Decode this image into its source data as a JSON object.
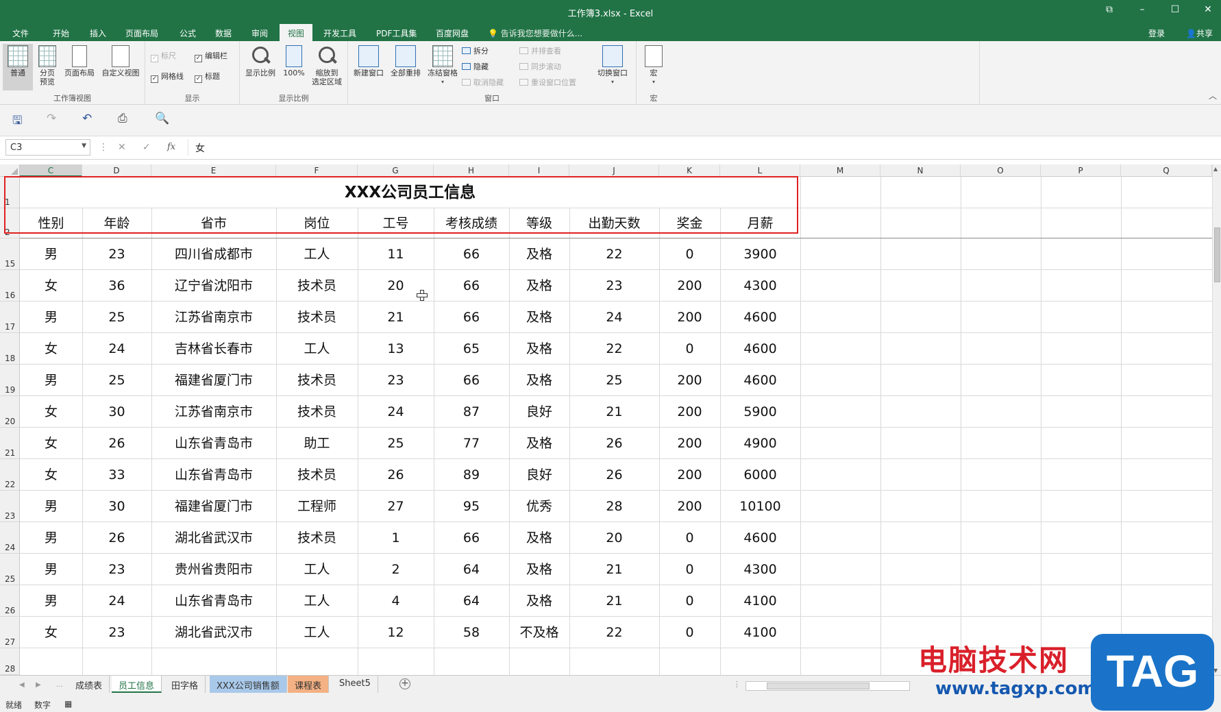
{
  "window": {
    "title": "工作簿3.xlsx - Excel",
    "buttons": [
      "⧉",
      "–",
      "☐",
      "✕"
    ]
  },
  "menu": {
    "tabs": [
      "文件",
      "开始",
      "插入",
      "页面布局",
      "公式",
      "数据",
      "审阅",
      "视图",
      "开发工具",
      "PDF工具集",
      "百度网盘"
    ],
    "active_tab": "视图",
    "tell_me": "告诉我您想要做什么...",
    "login": "登录",
    "share": "共享"
  },
  "ribbon": {
    "workbook_views": {
      "label": "工作簿视图",
      "normal": "普通",
      "page_break": "分页\n预览",
      "page_layout": "页面布局",
      "custom": "自定义视图"
    },
    "show": {
      "label": "显示",
      "ruler": "标尺",
      "formula_bar": "编辑栏",
      "gridlines": "网格线",
      "headings": "标题"
    },
    "zoom": {
      "label": "显示比例",
      "zoom": "显示比例",
      "hundred": "100%",
      "to_selection": "缩放到\n选定区域"
    },
    "window": {
      "label": "窗口",
      "new_window": "新建窗口",
      "arrange_all": "全部重排",
      "freeze_panes": "冻结窗格",
      "split": "拆分",
      "hide": "隐藏",
      "unhide": "取消隐藏",
      "side_by_side": "并排查看",
      "sync_scroll": "同步滚动",
      "reset_position": "重设窗口位置",
      "switch_windows": "切换窗口"
    },
    "macros": {
      "label": "宏",
      "macros": "宏"
    }
  },
  "formula_bar": {
    "name_box": "C3",
    "value": "女"
  },
  "sheet": {
    "columns": [
      "C",
      "D",
      "E",
      "F",
      "G",
      "H",
      "I",
      "J",
      "K",
      "L",
      "M",
      "N",
      "O",
      "P",
      "Q"
    ],
    "selected_column": "C",
    "title": "XXX公司员工信息",
    "headers": [
      "性别",
      "年龄",
      "省市",
      "岗位",
      "工号",
      "考核成绩",
      "等级",
      "出勤天数",
      "奖金",
      "月薪"
    ],
    "row_numbers": [
      "1",
      "2",
      "15",
      "16",
      "17",
      "18",
      "19",
      "20",
      "21",
      "22",
      "23",
      "24",
      "25",
      "26",
      "27",
      "28"
    ],
    "rows": [
      [
        "男",
        "23",
        "四川省成都市",
        "工人",
        "11",
        "66",
        "及格",
        "22",
        "0",
        "3900"
      ],
      [
        "女",
        "36",
        "辽宁省沈阳市",
        "技术员",
        "20",
        "66",
        "及格",
        "23",
        "200",
        "4300"
      ],
      [
        "男",
        "25",
        "江苏省南京市",
        "技术员",
        "21",
        "66",
        "及格",
        "24",
        "200",
        "4600"
      ],
      [
        "女",
        "24",
        "吉林省长春市",
        "工人",
        "13",
        "65",
        "及格",
        "22",
        "0",
        "4600"
      ],
      [
        "男",
        "25",
        "福建省厦门市",
        "技术员",
        "23",
        "66",
        "及格",
        "25",
        "200",
        "4600"
      ],
      [
        "女",
        "30",
        "江苏省南京市",
        "技术员",
        "24",
        "87",
        "良好",
        "21",
        "200",
        "5900"
      ],
      [
        "女",
        "26",
        "山东省青岛市",
        "助工",
        "25",
        "77",
        "及格",
        "26",
        "200",
        "4900"
      ],
      [
        "女",
        "33",
        "山东省青岛市",
        "技术员",
        "26",
        "89",
        "良好",
        "26",
        "200",
        "6000"
      ],
      [
        "男",
        "30",
        "福建省厦门市",
        "工程师",
        "27",
        "95",
        "优秀",
        "28",
        "200",
        "10100"
      ],
      [
        "男",
        "26",
        "湖北省武汉市",
        "技术员",
        "1",
        "66",
        "及格",
        "20",
        "0",
        "4600"
      ],
      [
        "男",
        "23",
        "贵州省贵阳市",
        "工人",
        "2",
        "64",
        "及格",
        "21",
        "0",
        "4300"
      ],
      [
        "男",
        "24",
        "山东省青岛市",
        "工人",
        "4",
        "64",
        "及格",
        "21",
        "0",
        "4100"
      ],
      [
        "女",
        "23",
        "湖北省武汉市",
        "工人",
        "12",
        "58",
        "不及格",
        "22",
        "0",
        "4100"
      ]
    ]
  },
  "sheet_tabs": {
    "tabs": [
      "成绩表",
      "员工信息",
      "田字格",
      "XXX公司销售额",
      "课程表",
      "Sheet5"
    ],
    "active": "员工信息"
  },
  "status": {
    "ready": "就绪",
    "numlock": "数字"
  },
  "watermark": {
    "text": "电脑技术网",
    "url": "www.tagxp.com",
    "logo": "TAG"
  },
  "colors": {
    "excel_green": "#217346",
    "highlight_red": "#e02020",
    "tab_blue": "#a9c9ea",
    "tab_orange": "#f4b183"
  }
}
